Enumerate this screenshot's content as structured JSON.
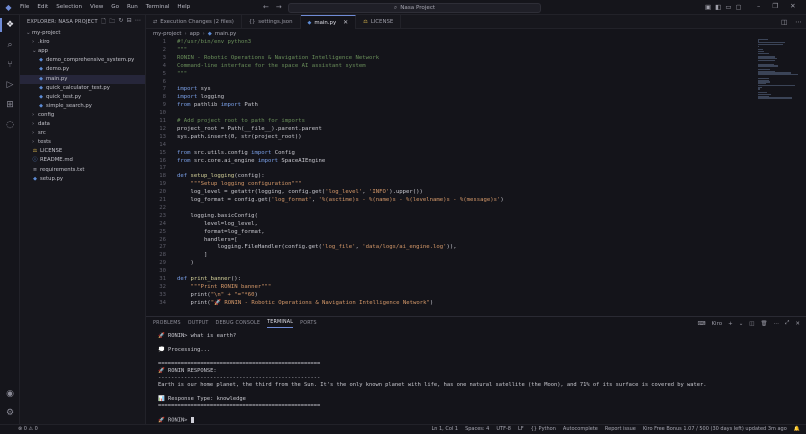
{
  "titlebar": {
    "menu": [
      "File",
      "Edit",
      "Selection",
      "View",
      "Go",
      "Run",
      "Terminal",
      "Help"
    ],
    "search_text": "Nasa Project"
  },
  "sidebar": {
    "header": "EXPLORER: NASA PROJECT",
    "items": [
      {
        "label": "my-project",
        "type": "folder-open",
        "depth": 0
      },
      {
        "label": ".kiro",
        "type": "folder",
        "depth": 1
      },
      {
        "label": "app",
        "type": "folder-open",
        "depth": 1
      },
      {
        "label": "demo_comprehensive_system.py",
        "type": "py",
        "depth": 2
      },
      {
        "label": "demo.py",
        "type": "py",
        "depth": 2
      },
      {
        "label": "main.py",
        "type": "py",
        "depth": 2,
        "selected": true
      },
      {
        "label": "quick_calculator_test.py",
        "type": "py",
        "depth": 2
      },
      {
        "label": "quick_test.py",
        "type": "py",
        "depth": 2
      },
      {
        "label": "simple_search.py",
        "type": "py",
        "depth": 2
      },
      {
        "label": "config",
        "type": "folder",
        "depth": 1
      },
      {
        "label": "data",
        "type": "folder",
        "depth": 1
      },
      {
        "label": "src",
        "type": "folder",
        "depth": 1
      },
      {
        "label": "tests",
        "type": "folder",
        "depth": 1
      },
      {
        "label": "LICENSE",
        "type": "license",
        "depth": 1
      },
      {
        "label": "README.md",
        "type": "md",
        "depth": 1
      },
      {
        "label": "requirements.txt",
        "type": "txt",
        "depth": 1
      },
      {
        "label": "setup.py",
        "type": "py",
        "depth": 1
      }
    ]
  },
  "tabs": [
    {
      "label": "Execution Changes (2 files)",
      "icon": "diff-icon",
      "active": false
    },
    {
      "label": "settings.json",
      "icon": "json-icon",
      "active": false
    },
    {
      "label": "main.py",
      "icon": "python-icon",
      "active": true
    },
    {
      "label": "LICENSE",
      "icon": "license-icon",
      "active": false
    }
  ],
  "breadcrumb": [
    "my-project",
    "app",
    "main.py"
  ],
  "code": [
    [
      {
        "t": "#!/usr/bin/env python3",
        "c": "sh"
      }
    ],
    [
      {
        "t": "\"\"\"",
        "c": "cm"
      }
    ],
    [
      {
        "t": "RONIN - Robotic Operations & Navigation Intelligence Network",
        "c": "cm"
      }
    ],
    [
      {
        "t": "Command-line interface for the space AI assistant system",
        "c": "cm"
      }
    ],
    [
      {
        "t": "\"\"\"",
        "c": "cm"
      }
    ],
    [],
    [
      {
        "t": "import",
        "c": "kw"
      },
      {
        "t": " sys",
        "c": "tx"
      }
    ],
    [
      {
        "t": "import",
        "c": "kw"
      },
      {
        "t": " logging",
        "c": "tx"
      }
    ],
    [
      {
        "t": "from",
        "c": "kw"
      },
      {
        "t": " pathlib ",
        "c": "tx"
      },
      {
        "t": "import",
        "c": "kw"
      },
      {
        "t": " Path",
        "c": "tx"
      }
    ],
    [],
    [
      {
        "t": "# Add project root to path for imports",
        "c": "cm"
      }
    ],
    [
      {
        "t": "project_root = Path(__file__).parent.parent",
        "c": "tx"
      }
    ],
    [
      {
        "t": "sys.path.insert(0, str(project_root))",
        "c": "tx"
      }
    ],
    [],
    [
      {
        "t": "from",
        "c": "kw"
      },
      {
        "t": " src.utils.config ",
        "c": "tx"
      },
      {
        "t": "import",
        "c": "kw"
      },
      {
        "t": " Config",
        "c": "tx"
      }
    ],
    [
      {
        "t": "from",
        "c": "kw"
      },
      {
        "t": " src.core.ai_engine ",
        "c": "tx"
      },
      {
        "t": "import",
        "c": "kw"
      },
      {
        "t": " SpaceAIEngine",
        "c": "tx"
      }
    ],
    [],
    [
      {
        "t": "def",
        "c": "kw"
      },
      {
        "t": " setup_logging",
        "c": "fn"
      },
      {
        "t": "(config):",
        "c": "tx"
      }
    ],
    [
      {
        "t": "    \"\"\"Setup logging configuration\"\"\"",
        "c": "str"
      }
    ],
    [
      {
        "t": "    log_level = getattr(logging, config.get(",
        "c": "tx"
      },
      {
        "t": "'log_level'",
        "c": "str"
      },
      {
        "t": ", ",
        "c": "tx"
      },
      {
        "t": "'INFO'",
        "c": "str"
      },
      {
        "t": ").upper())",
        "c": "tx"
      }
    ],
    [
      {
        "t": "    log_format = config.get(",
        "c": "tx"
      },
      {
        "t": "'log_format'",
        "c": "str"
      },
      {
        "t": ", ",
        "c": "tx"
      },
      {
        "t": "'%(asctime)s - %(name)s - %(levelname)s - %(message)s'",
        "c": "str"
      },
      {
        "t": ")",
        "c": "tx"
      }
    ],
    [],
    [
      {
        "t": "    logging.basicConfig(",
        "c": "tx"
      }
    ],
    [
      {
        "t": "        level=log_level,",
        "c": "tx"
      }
    ],
    [
      {
        "t": "        format=log_format,",
        "c": "tx"
      }
    ],
    [
      {
        "t": "        handlers=[",
        "c": "tx"
      }
    ],
    [
      {
        "t": "            logging.FileHandler(config.get(",
        "c": "tx"
      },
      {
        "t": "'log_file'",
        "c": "str"
      },
      {
        "t": ", ",
        "c": "tx"
      },
      {
        "t": "'data/logs/ai_engine.log'",
        "c": "str"
      },
      {
        "t": ")),",
        "c": "tx"
      }
    ],
    [
      {
        "t": "        ]",
        "c": "tx"
      }
    ],
    [
      {
        "t": "    )",
        "c": "tx"
      }
    ],
    [],
    [
      {
        "t": "def",
        "c": "kw"
      },
      {
        "t": " print_banner",
        "c": "fn"
      },
      {
        "t": "():",
        "c": "tx"
      }
    ],
    [
      {
        "t": "    \"\"\"Print RONIN banner\"\"\"",
        "c": "str"
      }
    ],
    [
      {
        "t": "    print(",
        "c": "tx"
      },
      {
        "t": "\"\\n\" + \"=\"*60",
        "c": "str"
      },
      {
        "t": ")",
        "c": "tx"
      }
    ],
    [
      {
        "t": "    print(",
        "c": "tx"
      },
      {
        "t": "\"🚀 RONIN - Robotic Operations & Navigation Intelligence Network\"",
        "c": "str"
      },
      {
        "t": ")",
        "c": "tx"
      }
    ]
  ],
  "panel": {
    "tabs": [
      "PROBLEMS",
      "OUTPUT",
      "DEBUG CONSOLE",
      "TERMINAL",
      "PORTS"
    ],
    "active_tab": "TERMINAL",
    "shell_label": "Kiro",
    "terminal": [
      "🚀 RONIN> what is earth?",
      "",
      "💭 Processing...",
      "",
      "==================================================",
      "🚀 RONIN RESPONSE:",
      "--------------------------------------------------",
      "Earth is our home planet, the third from the Sun. It's the only known planet with life, has one natural satellite (the Moon), and 71% of its surface is covered by water.",
      "",
      "📊 Response Type: knowledge",
      "==================================================",
      "",
      "🚀 RONIN> "
    ]
  },
  "statusbar": {
    "problems": "⊗ 0 ⚠ 0",
    "position": "Ln 1, Col 1",
    "spaces": "Spaces: 4",
    "encoding": "UTF-8",
    "eol": "LF",
    "language": "{} Python",
    "autocomplete": "Autocomplete",
    "report": "Report issue",
    "usage": "Kiro Free Bonus 1.07 / 500 (30 days left) updated 3m ago"
  },
  "colors": {
    "accent": "#6f8bd6",
    "background": "#14141a",
    "keyword": "#7aa0e8",
    "string": "#d79a6a",
    "comment": "#6a8f5a"
  }
}
